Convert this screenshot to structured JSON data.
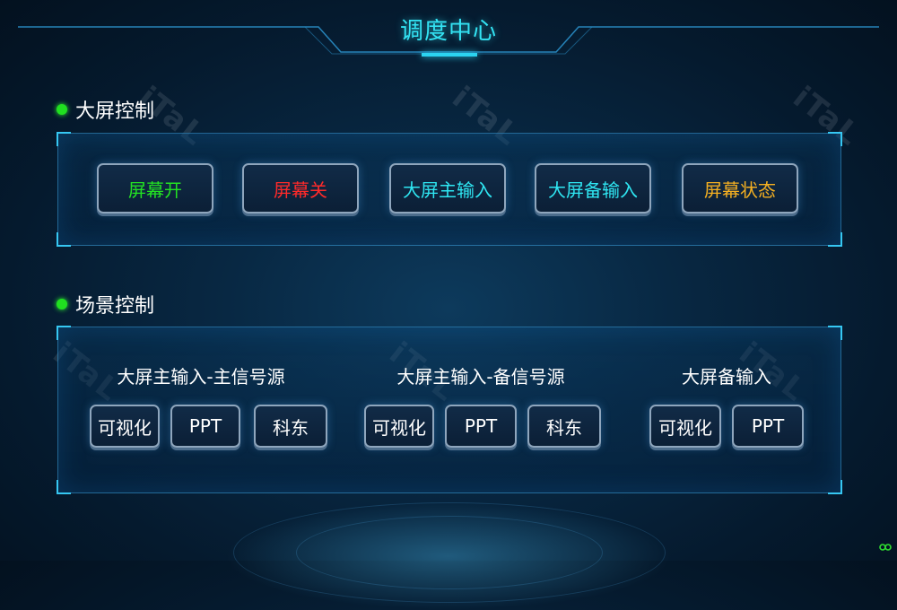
{
  "header": {
    "title": "调度中心"
  },
  "screen_control": {
    "heading": "大屏控制",
    "buttons": [
      {
        "label": "屏幕开",
        "color": "#23e223"
      },
      {
        "label": "屏幕关",
        "color": "#ff2a2a"
      },
      {
        "label": "大屏主输入",
        "color": "#2fe6f2"
      },
      {
        "label": "大屏备输入",
        "color": "#2fe6f2"
      },
      {
        "label": "屏幕状态",
        "color": "#f5b021"
      }
    ]
  },
  "scene_control": {
    "heading": "场景控制",
    "groups": [
      {
        "title": "大屏主输入-主信号源",
        "buttons": [
          "可视化",
          "PPT",
          "科东"
        ]
      },
      {
        "title": "大屏主输入-备信号源",
        "buttons": [
          "可视化",
          "PPT",
          "科东"
        ]
      },
      {
        "title": "大屏备输入",
        "buttons": [
          "可视化",
          "PPT"
        ]
      }
    ]
  },
  "watermark": {
    "text": "iTaL",
    "icon": "italc-logo-watermark"
  },
  "colors": {
    "accent": "#33e3f3",
    "dot": "#20e020",
    "panel_border": "#36c7f2"
  }
}
